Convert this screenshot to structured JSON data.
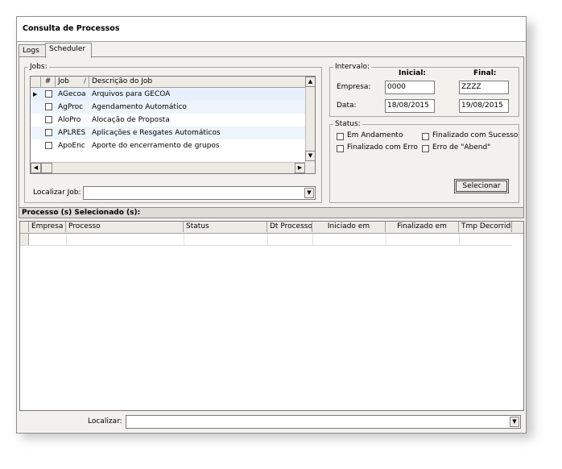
{
  "window": {
    "title": "Consulta de Processos"
  },
  "tabs": [
    {
      "label": "Logs"
    },
    {
      "label": "Scheduler"
    }
  ],
  "jobs": {
    "legend": "Jobs:",
    "columns": {
      "check": "#",
      "job": "Job",
      "sort_marker": "/",
      "descricao": "Descrição do Job"
    },
    "rows": [
      {
        "job": "AGecoa",
        "descricao": "Arquivos para GECOA",
        "current": true
      },
      {
        "job": "AgProc",
        "descricao": "Agendamento Automático",
        "current": false
      },
      {
        "job": "AloPro",
        "descricao": "Alocação de Proposta",
        "current": false
      },
      {
        "job": "APLRES",
        "descricao": "Aplicações e Resgates Automáticos",
        "current": false
      },
      {
        "job": "ApoEnc",
        "descricao": "Aporte do encerramento de grupos",
        "current": false
      }
    ],
    "localizar_label": "Localizar Job:",
    "localizar_value": ""
  },
  "intervalo": {
    "legend": "Intervalo:",
    "inicial_label": "Inicial:",
    "final_label": "Final:",
    "empresa_label": "Empresa:",
    "empresa_inicial": "0000",
    "empresa_final": "ZZZZ",
    "data_label": "Data:",
    "data_inicial": "18/08/2015",
    "data_final": "19/08/2015"
  },
  "status": {
    "legend": "Status:",
    "em_andamento": "Em Andamento",
    "finalizado_sucesso": "Finalizado com Sucesso",
    "finalizado_erro": "Finalizado com Erro",
    "erro_abend": "Erro de \"Abend\"",
    "selecionar_button": "Selecionar"
  },
  "processos": {
    "title": "Processo (s) Selecionado (s):",
    "columns": [
      "Empresa",
      "Processo",
      "Status",
      "Dt Processo",
      "Iniciado em",
      "Finalizado em",
      "Tmp Decorrido"
    ]
  },
  "footer": {
    "localizar_label": "Localizar:",
    "localizar_value": ""
  }
}
